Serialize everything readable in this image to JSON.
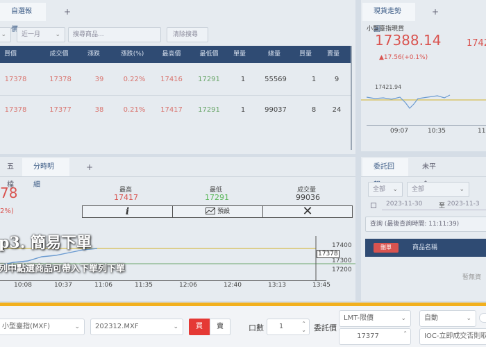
{
  "watchlist": {
    "tab_label": "自選報價",
    "filter_value": "近一月",
    "search_placeholder": "搜尋商品...",
    "clear_label": "清除搜尋",
    "columns": [
      "買價",
      "成交價",
      "漲跌",
      "漲跌(%)",
      "最高價",
      "最低價",
      "單量",
      "總量",
      "買量",
      "賣量"
    ],
    "rows": [
      {
        "buy": "17378",
        "last": "17378",
        "change": "39",
        "pct": "0.22%",
        "high": "17416",
        "low": "17291",
        "single": "1",
        "total": "55569",
        "bidvol": "1",
        "askvol": "9"
      },
      {
        "buy": "17378",
        "last": "17377",
        "change": "38",
        "pct": "0.21%",
        "high": "17417",
        "low": "17291",
        "single": "1",
        "total": "99037",
        "bidvol": "8",
        "askvol": "24"
      }
    ]
  },
  "spot": {
    "tab_label": "現貨走勢圖",
    "name": "小型臺指現貨",
    "price": "17388.14",
    "price2": "1742",
    "change": "▲17.56(+0.1%)",
    "chart_label": "17421.94",
    "times": [
      "09:07",
      "10:35",
      "11:5"
    ]
  },
  "detail": {
    "tabs": [
      "五檔",
      "分時明細"
    ],
    "big_value": "78",
    "big_pct": "2%)",
    "high_label": "最高",
    "high_value": "17417",
    "low_label": "最低",
    "low_value": "17291",
    "vol_label": "成交量",
    "vol_value": "99036",
    "preset_label": "預設",
    "price_ticks": [
      "17400",
      "17300",
      "17200"
    ],
    "price_box": "17378",
    "times": [
      "10:08",
      "10:37",
      "11:06",
      "11:35",
      "12:06",
      "12:40",
      "13:13",
      "13:45"
    ]
  },
  "orders": {
    "tabs": [
      "委託回報",
      "未平倉"
    ],
    "select1": "全部",
    "select2": "全部",
    "date_from": "2023-11-30",
    "tilde": "至",
    "date_to": "2023-11-3",
    "query_text": "查詢 (最後查詢時間: 11:11:39)",
    "delete_btn": "刪單",
    "col_product": "商品名稱",
    "empty_text": "暫無資"
  },
  "overlay": {
    "step_title": "p3. 簡易下單",
    "step_subtitle": "列中點選商品可帶入下單列下單"
  },
  "order_bar": {
    "product": "小型臺指(MXF)",
    "contract": "202312.MXF",
    "buy_label": "買",
    "sell_label": "賣",
    "qty_label": "口數",
    "qty_value": "1",
    "price_label": "委託價",
    "price_type": "LMT-限價",
    "price_value": "17377",
    "auto_label": "自動",
    "ioc_label": "IOC-立即成交否則取"
  },
  "colors": {
    "accent": "#f2b01e",
    "header": "#2f4b73",
    "up": "#d9534f",
    "down": "#5cb85c"
  }
}
